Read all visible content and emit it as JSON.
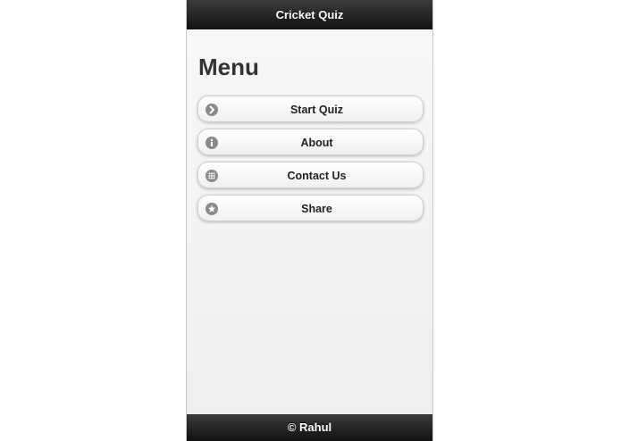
{
  "header": {
    "title": "Cricket Quiz"
  },
  "page": {
    "title": "Menu"
  },
  "menu": {
    "items": [
      {
        "label": "Start Quiz",
        "icon": "arrow-right-icon"
      },
      {
        "label": "About",
        "icon": "info-icon"
      },
      {
        "label": "Contact Us",
        "icon": "grid-icon"
      },
      {
        "label": "Share",
        "icon": "star-icon"
      }
    ]
  },
  "footer": {
    "text": "© Rahul"
  },
  "colors": {
    "bar_background": "#1a1a1a",
    "page_background": "#f2f2f2",
    "icon_gray": "#8a8a8a"
  }
}
